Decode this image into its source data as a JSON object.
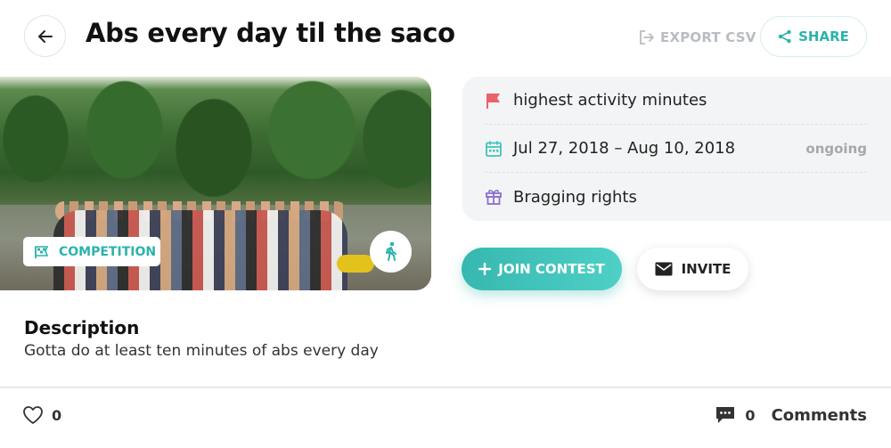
{
  "header": {
    "title": "Abs every day til the saco",
    "export_label": "EXPORT CSV",
    "share_label": "SHARE"
  },
  "contest": {
    "type_badge": "COMPETITION",
    "goal": "highest activity minutes",
    "dates": "Jul 27, 2018 – Aug 10, 2018",
    "status": "ongoing",
    "prize": "Bragging rights"
  },
  "actions": {
    "join_label": "JOIN CONTEST",
    "invite_label": "INVITE"
  },
  "description": {
    "heading": "Description",
    "text": "Gotta do at least ten minutes of abs every day"
  },
  "footer": {
    "likes_count": "0",
    "comments_count": "0",
    "comments_label": "Comments"
  },
  "colors": {
    "accent": "#2bb3ad",
    "flag": "#e8636a",
    "calendar": "#3fc4bb",
    "gift": "#8b6fd0"
  }
}
